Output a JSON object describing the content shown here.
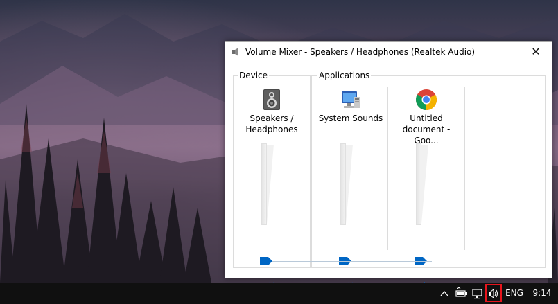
{
  "window": {
    "title": "Volume Mixer - Speakers / Headphones (Realtek Audio)",
    "close_glyph": "✕"
  },
  "device_group": {
    "label": "Device",
    "channel": {
      "name": "Speakers /\nHeadphones",
      "icon": "speakers-device-icon",
      "volume_percent": 0
    }
  },
  "apps_group": {
    "label": "Applications",
    "channels": [
      {
        "name": "System Sounds",
        "icon": "system-sounds-icon",
        "volume_percent": 0
      },
      {
        "name": "Untitled\ndocument - Goo...",
        "icon": "chrome-icon",
        "volume_percent": 0
      }
    ]
  },
  "taskbar": {
    "language": "ENG",
    "time": "9:14",
    "tray_icons": [
      "chevron-up-icon",
      "battery-icon",
      "network-icon",
      "speaker-icon"
    ]
  },
  "colors": {
    "accent": "#0066c4",
    "highlight": "#e8141c",
    "taskbar": "#101010"
  }
}
